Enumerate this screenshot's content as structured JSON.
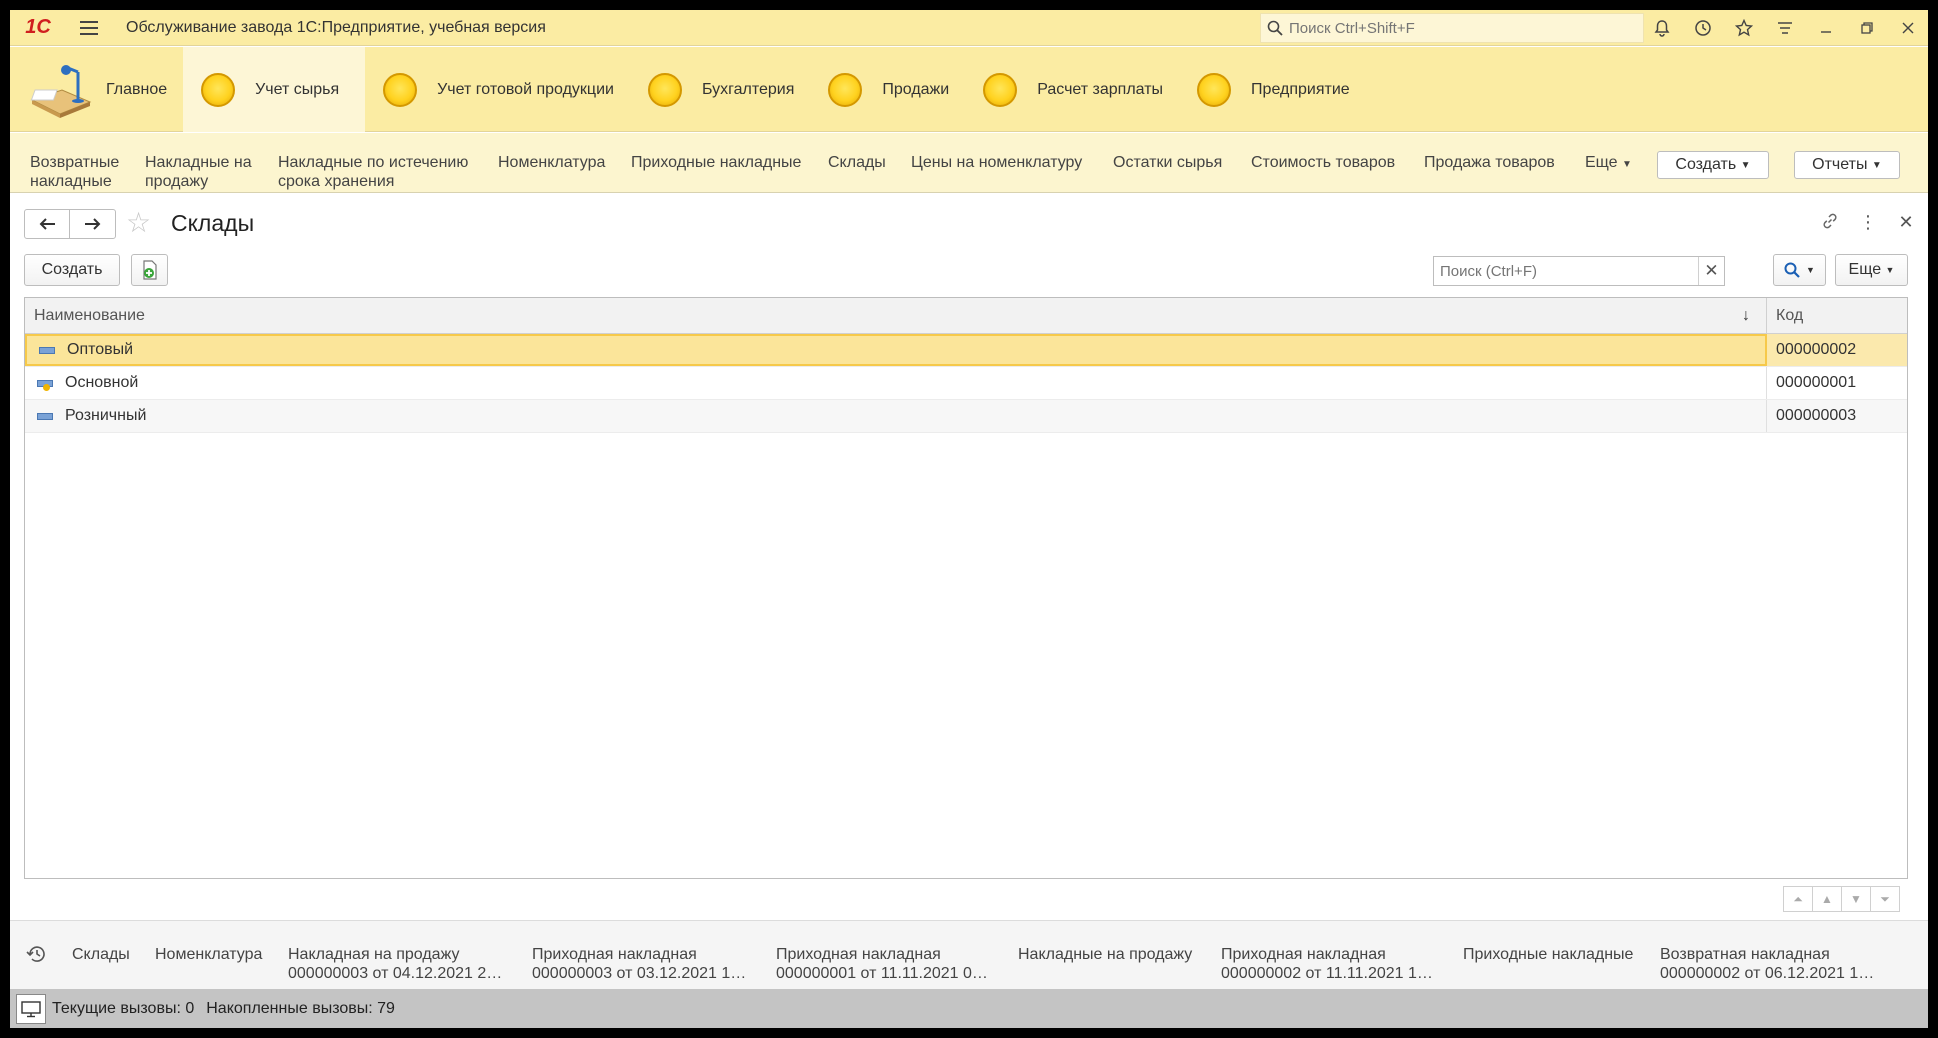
{
  "window": {
    "logo": "1С",
    "title": "Обслуживание завода 1С:Предприятие, учебная версия",
    "search_placeholder": "Поиск Ctrl+Shift+F"
  },
  "sections": {
    "home": "Главное",
    "items": [
      "Учет сырья",
      "Учет готовой продукции",
      "Бухгалтерия",
      "Продажи",
      "Расчет зарплаты",
      "Предприятие"
    ],
    "active_index": 0
  },
  "functions": {
    "items": [
      {
        "l1": "Возвратные",
        "l2": "накладные"
      },
      {
        "l1": "Накладные на",
        "l2": "продажу"
      },
      {
        "l1": "Накладные по истечению",
        "l2": "срока хранения"
      },
      {
        "l1": "Номенклатура",
        "l2": ""
      },
      {
        "l1": "Приходные накладные",
        "l2": ""
      },
      {
        "l1": "Склады",
        "l2": ""
      },
      {
        "l1": "Цены на номенклатуру",
        "l2": ""
      },
      {
        "l1": "Остатки сырья",
        "l2": ""
      },
      {
        "l1": "Стоимость товаров",
        "l2": ""
      },
      {
        "l1": "Продажа товаров",
        "l2": ""
      }
    ],
    "more": "Еще",
    "create": "Создать",
    "reports": "Отчеты"
  },
  "form": {
    "title": "Склады",
    "create_button": "Создать",
    "search_placeholder": "Поиск (Ctrl+F)",
    "more": "Еще"
  },
  "table": {
    "columns": [
      "Наименование",
      "Код"
    ],
    "rows": [
      {
        "name": "Оптовый",
        "code": "000000002",
        "selected": true,
        "main": false
      },
      {
        "name": "Основной",
        "code": "000000001",
        "selected": false,
        "main": true
      },
      {
        "name": "Розничный",
        "code": "000000003",
        "selected": false,
        "main": false
      }
    ]
  },
  "history": {
    "items": [
      {
        "l1": "Склады",
        "l2": ""
      },
      {
        "l1": "Номенклатура",
        "l2": ""
      },
      {
        "l1": "Накладная на продажу",
        "l2": "000000003 от 04.12.2021 2…"
      },
      {
        "l1": "Приходная накладная",
        "l2": "000000003 от 03.12.2021 1…"
      },
      {
        "l1": "Приходная накладная",
        "l2": "000000001 от 11.11.2021 0…"
      },
      {
        "l1": "Накладные на продажу",
        "l2": ""
      },
      {
        "l1": "Приходная накладная",
        "l2": "000000002 от 11.11.2021 1…"
      },
      {
        "l1": "Приходные накладные",
        "l2": ""
      },
      {
        "l1": "Возвратная накладная",
        "l2": "000000002 от 06.12.2021 1…"
      }
    ]
  },
  "status": {
    "current_calls": "Текущие вызовы: 0",
    "accumulated_calls": "Накопленные вызовы: 79"
  },
  "colors": {
    "panel": "#fbeca3",
    "active_section": "#fdf6d6",
    "selected_row": "#fbe59a",
    "logo": "#d01f1f"
  }
}
